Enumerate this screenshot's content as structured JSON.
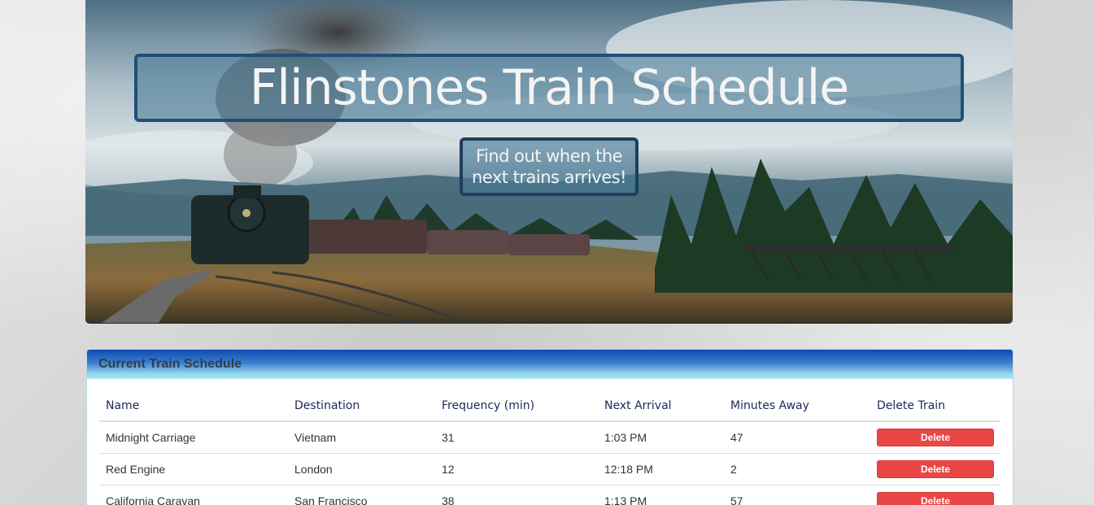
{
  "banner": {
    "title": "Flinstones Train Schedule",
    "subtitle": "Find out when the next trains arrives!"
  },
  "schedule": {
    "heading": "Current Train Schedule",
    "columns": [
      "Name",
      "Destination",
      "Frequency (min)",
      "Next Arrival",
      "Minutes Away",
      "Delete Train"
    ],
    "rows": [
      {
        "name": "Midnight Carriage",
        "destination": "Vietnam",
        "frequency": "31",
        "next_arrival": "1:03 PM",
        "minutes_away": "47",
        "delete_label": "Delete"
      },
      {
        "name": "Red Engine",
        "destination": "London",
        "frequency": "12",
        "next_arrival": "12:18 PM",
        "minutes_away": "2",
        "delete_label": "Delete"
      },
      {
        "name": "California Caravan",
        "destination": "San Francisco",
        "frequency": "38",
        "next_arrival": "1:13 PM",
        "minutes_away": "57",
        "delete_label": "Delete"
      }
    ]
  },
  "colors": {
    "panel_heading_start": "#0f4bb0",
    "panel_heading_end": "#b4e9f7",
    "delete_button": "#ea4646",
    "title_box_border": "#1f4f78"
  }
}
